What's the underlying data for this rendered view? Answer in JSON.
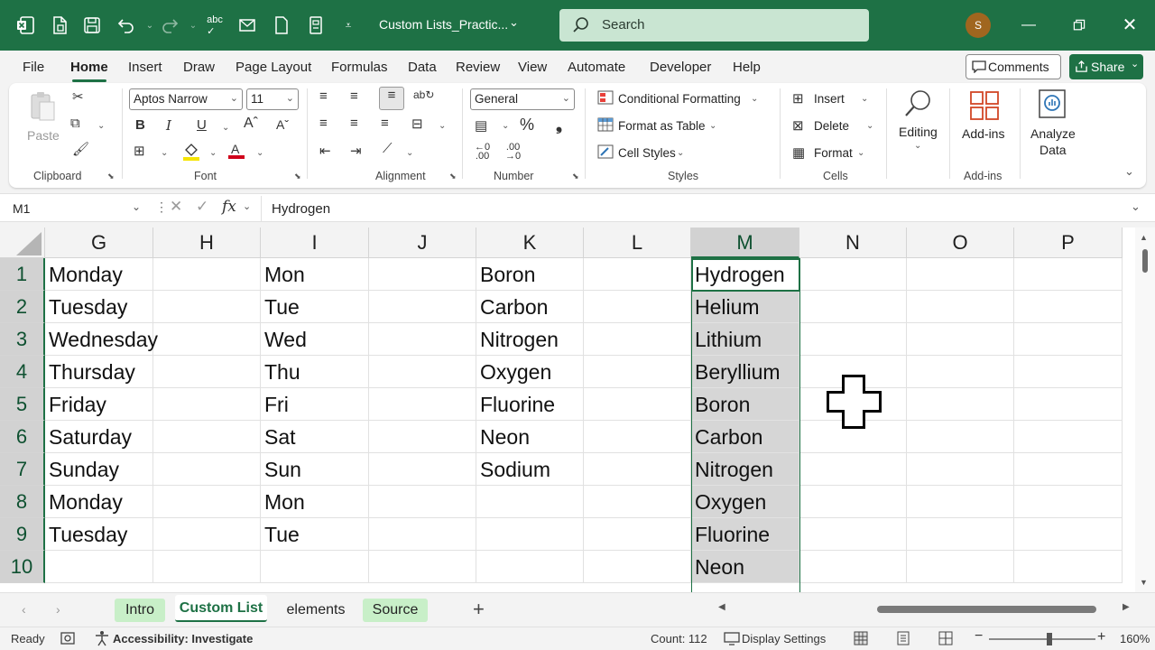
{
  "titlebar": {
    "doc_title": "Custom Lists_Practic...",
    "search_placeholder": "Search",
    "avatar_initial": "S"
  },
  "menu": {
    "tabs": [
      "File",
      "Home",
      "Insert",
      "Draw",
      "Page Layout",
      "Formulas",
      "Data",
      "Review",
      "View",
      "Automate",
      "Developer",
      "Help"
    ],
    "active": "Home",
    "comments_label": "Comments",
    "share_label": "Share"
  },
  "ribbon": {
    "clipboard": {
      "paste": "Paste",
      "group": "Clipboard"
    },
    "font": {
      "name": "Aptos Narrow",
      "size": "11",
      "group": "Font"
    },
    "alignment": {
      "group": "Alignment"
    },
    "number": {
      "format": "General",
      "group": "Number"
    },
    "styles": {
      "conditional": "Conditional Formatting",
      "table": "Format as Table",
      "cell_styles": "Cell Styles",
      "group": "Styles"
    },
    "cells": {
      "insert": "Insert",
      "delete": "Delete",
      "format": "Format",
      "group": "Cells"
    },
    "editing": {
      "label": "Editing"
    },
    "addins": {
      "label": "Add-ins",
      "group": "Add-ins"
    },
    "analyze": {
      "line1": "Analyze",
      "line2": "Data"
    }
  },
  "formula_bar": {
    "name_box": "M1",
    "fx": "fx",
    "formula": "Hydrogen"
  },
  "grid": {
    "columns": [
      "G",
      "H",
      "I",
      "J",
      "K",
      "L",
      "M",
      "N",
      "O",
      "P"
    ],
    "rows": [
      "1",
      "2",
      "3",
      "4",
      "5",
      "6",
      "7",
      "8",
      "9",
      "10"
    ],
    "col_g": [
      "Monday",
      "Tuesday",
      "Wednesday",
      "Thursday",
      "Friday",
      "Saturday",
      "Sunday",
      "Monday",
      "Tuesday",
      ""
    ],
    "col_i": [
      "Mon",
      "Tue",
      "Wed",
      "Thu",
      "Fri",
      "Sat",
      "Sun",
      "Mon",
      "Tue",
      ""
    ],
    "col_k": [
      "Boron",
      "Carbon",
      "Nitrogen",
      "Oxygen",
      "Fluorine",
      "Neon",
      "Sodium",
      "",
      "",
      ""
    ],
    "col_m": [
      "Hydrogen",
      "Helium",
      "Lithium",
      "Beryllium",
      "Boron",
      "Carbon",
      "Nitrogen",
      "Oxygen",
      "Fluorine",
      "Neon"
    ]
  },
  "sheets": {
    "tabs": [
      "Intro",
      "Custom List",
      "elements",
      "Source"
    ],
    "active": "Custom List"
  },
  "status": {
    "ready": "Ready",
    "accessibility": "Accessibility: Investigate",
    "count": "Count: 112",
    "display_settings": "Display Settings",
    "zoom": "160%"
  },
  "colors": {
    "brand": "#1e7145",
    "selection": "#d6d6d6"
  }
}
